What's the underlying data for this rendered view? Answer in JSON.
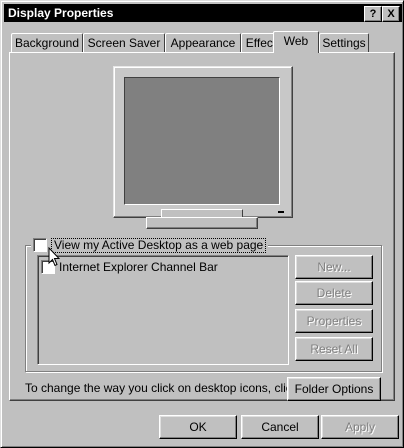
{
  "window": {
    "title": "Display Properties",
    "help_label": "?",
    "close_label": "X"
  },
  "tabs": [
    {
      "label": "Background"
    },
    {
      "label": "Screen Saver"
    },
    {
      "label": "Appearance"
    },
    {
      "label": "Effects"
    },
    {
      "label": "Web",
      "active": true
    },
    {
      "label": "Settings"
    }
  ],
  "active_desktop": {
    "label": "View my Active Desktop as a web page",
    "checked": false
  },
  "list": {
    "items": [
      {
        "label": "Internet Explorer Channel Bar",
        "checked": false
      }
    ]
  },
  "side_buttons": {
    "new": "New...",
    "delete": "Delete",
    "properties": "Properties",
    "reset_all": "Reset All"
  },
  "click_text": "To change the way you click on desktop icons, click:",
  "folder_options": "Folder Options",
  "bottom_buttons": {
    "ok": "OK",
    "cancel": "Cancel",
    "apply": "Apply"
  },
  "icons": {
    "cursor": "arrow-cursor-icon",
    "monitor": "monitor-preview-icon"
  }
}
